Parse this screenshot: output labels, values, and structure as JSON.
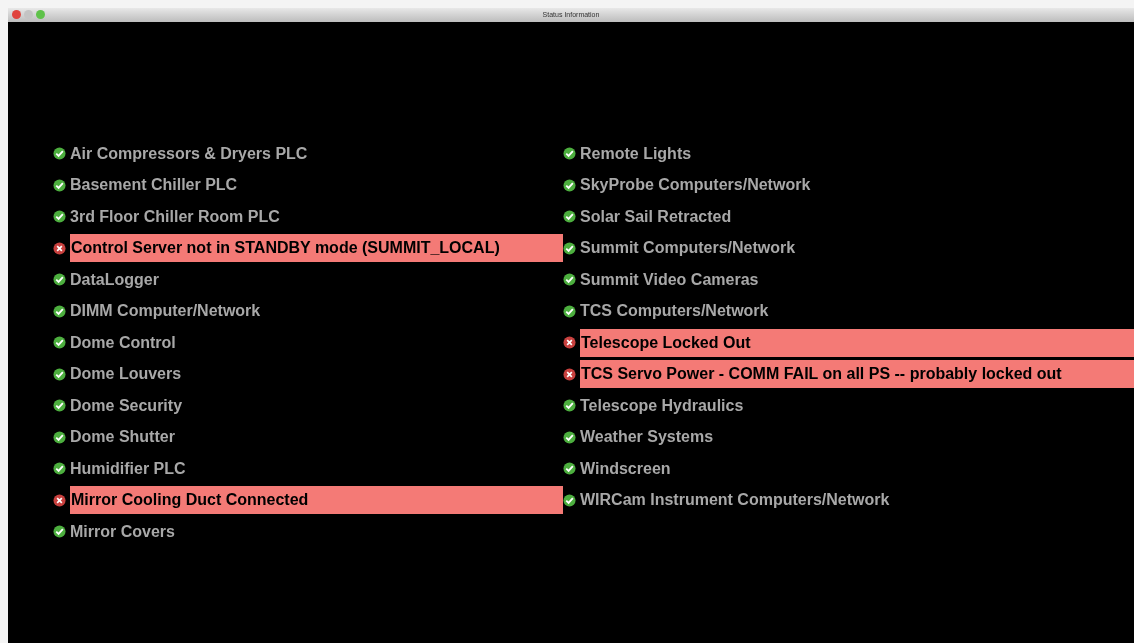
{
  "window": {
    "title": "Status Information"
  },
  "columns": [
    [
      {
        "label": "Air Compressors & Dryers PLC",
        "ok": true
      },
      {
        "label": "Basement Chiller PLC",
        "ok": true
      },
      {
        "label": "3rd Floor Chiller Room PLC",
        "ok": true
      },
      {
        "label": "Control Server not in STANDBY mode (SUMMIT_LOCAL)",
        "ok": false
      },
      {
        "label": "DataLogger",
        "ok": true
      },
      {
        "label": "DIMM Computer/Network",
        "ok": true
      },
      {
        "label": "Dome Control",
        "ok": true
      },
      {
        "label": "Dome Louvers",
        "ok": true
      },
      {
        "label": "Dome Security",
        "ok": true
      },
      {
        "label": "Dome Shutter",
        "ok": true
      },
      {
        "label": "Humidifier PLC",
        "ok": true
      },
      {
        "label": "Mirror Cooling Duct Connected",
        "ok": false
      },
      {
        "label": "Mirror Covers",
        "ok": true
      }
    ],
    [
      {
        "label": "Remote Lights",
        "ok": true
      },
      {
        "label": "SkyProbe Computers/Network",
        "ok": true
      },
      {
        "label": "Solar Sail Retracted",
        "ok": true
      },
      {
        "label": "Summit Computers/Network",
        "ok": true
      },
      {
        "label": "Summit Video Cameras",
        "ok": true
      },
      {
        "label": "TCS Computers/Network",
        "ok": true
      },
      {
        "label": "Telescope Locked Out",
        "ok": false
      },
      {
        "label": "TCS Servo Power - COMM FAIL on all PS -- probably locked out",
        "ok": false
      },
      {
        "label": "Telescope Hydraulics",
        "ok": true
      },
      {
        "label": "Weather Systems",
        "ok": true
      },
      {
        "label": "Windscreen",
        "ok": true
      },
      {
        "label": "WIRCam Instrument Computers/Network",
        "ok": true
      }
    ]
  ]
}
